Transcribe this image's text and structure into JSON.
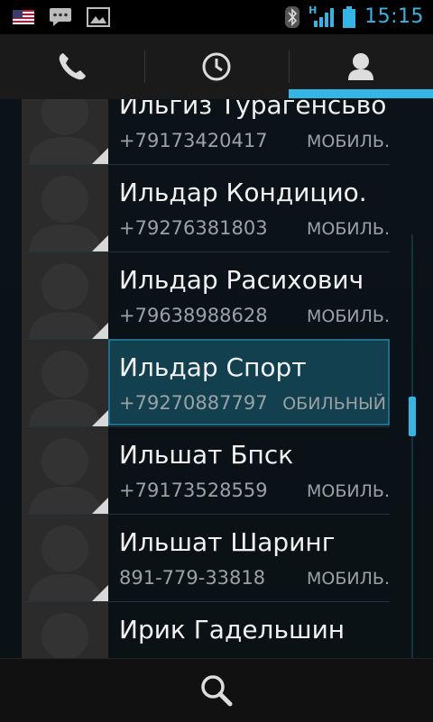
{
  "status_bar": {
    "time": "15:15",
    "network_type": "H",
    "icons": [
      "us-flag-icon",
      "message-icon",
      "image-icon",
      "bluetooth-icon",
      "signal-icon",
      "battery-icon"
    ]
  },
  "tabs": [
    {
      "name": "phone",
      "icon": "phone-icon",
      "active": false
    },
    {
      "name": "recent",
      "icon": "clock-icon",
      "active": false
    },
    {
      "name": "contacts",
      "icon": "person-icon",
      "active": true
    }
  ],
  "contacts": [
    {
      "name": "Ильгиз Турагенсьво",
      "phone": "+79173420417",
      "type": "МОБИЛЬ."
    },
    {
      "name": "Ильдар Кондицио.",
      "phone": "+79276381803",
      "type": "МОБИЛЬ."
    },
    {
      "name": "Ильдар Расихович",
      "phone": "+79638988628",
      "type": "МОБИЛЬ."
    },
    {
      "name": "Ильдар Спорт",
      "phone": "+79270887797",
      "type": "ОБИЛЬНЫЙ"
    },
    {
      "name": "Ильшат Бпск",
      "phone": "+79173528559",
      "type": "МОБИЛЬ."
    },
    {
      "name": "Ильшат Шаринг",
      "phone": "891-779-33818",
      "type": "МОБИЛЬ."
    },
    {
      "name": "Ирик Гадельшин",
      "phone": "",
      "type": ""
    }
  ],
  "colors": {
    "accent": "#33b5e5",
    "background": "#0b1318",
    "selected": "#13404f"
  },
  "bottom_bar": {
    "icon": "search-icon"
  }
}
